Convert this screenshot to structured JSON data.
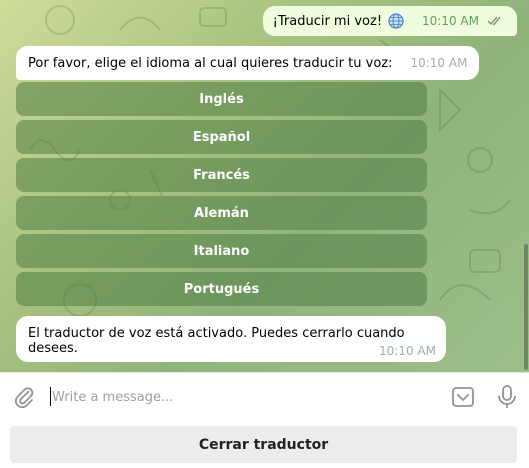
{
  "outgoing": {
    "text": "¡Traducir mi voz!",
    "icon": "globe-icon",
    "time": "10:10 AM",
    "status_icon": "double-check-icon",
    "status_color": "#5ea35a"
  },
  "prompt": {
    "text": "Por favor, elige el idioma al cual quieres traducir tu voz:",
    "time": "10:10 AM"
  },
  "keyboard": {
    "buttons": [
      "Inglés",
      "Español",
      "Francés",
      "Alemán",
      "Italiano",
      "Portugués"
    ]
  },
  "confirmation": {
    "text": "El traductor de voz está activado. Puedes cerrarlo cuando desees.",
    "time": "10:10 AM"
  },
  "composer": {
    "placeholder": "Write a message...",
    "attach_icon": "paperclip-icon",
    "keyboard_icon": "keyboard-toggle-icon",
    "mic_icon": "microphone-icon"
  },
  "reply_keyboard": {
    "button": "Cerrar traductor"
  },
  "colors": {
    "outgoing_bubble": "#effdde",
    "keyboard_button": "#6e9a63",
    "reply_button": "#ececec"
  }
}
